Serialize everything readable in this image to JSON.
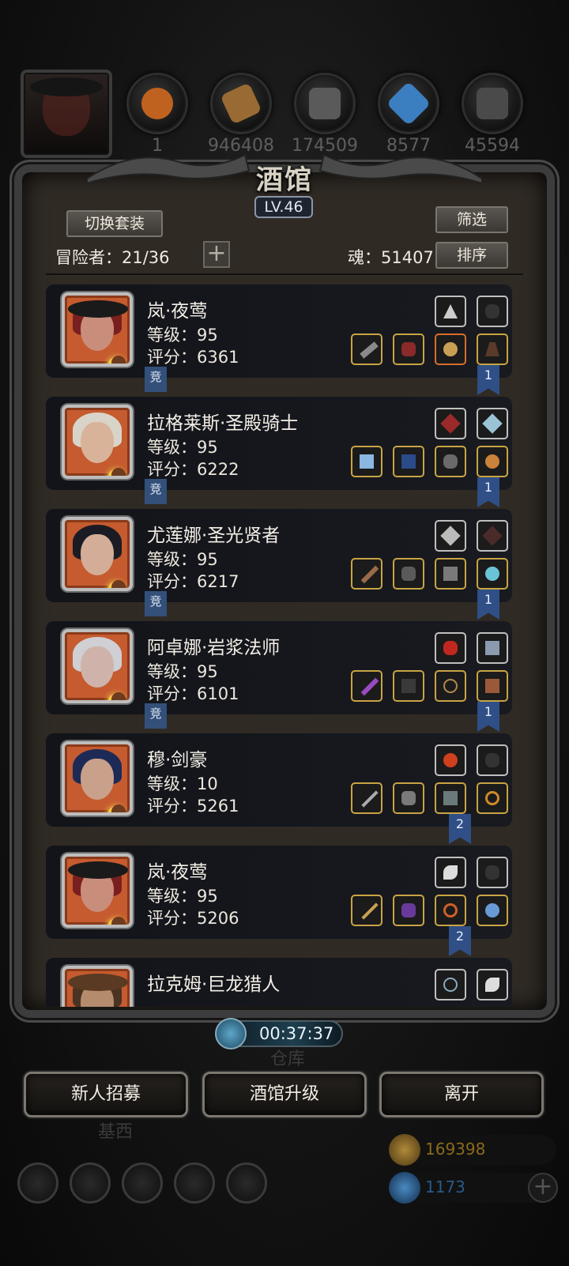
{
  "resources": [
    {
      "id": "res-1",
      "count": "1",
      "color": "#c0621f"
    },
    {
      "id": "res-2",
      "count": "946408",
      "color": "#9a6a34"
    },
    {
      "id": "res-3",
      "count": "174509",
      "color": "#5a5a5a"
    },
    {
      "id": "res-4",
      "count": "8577",
      "color": "#3c7fc0"
    },
    {
      "id": "res-5",
      "count": "45594",
      "color": "#4a4a4a"
    }
  ],
  "panel": {
    "title": "酒馆",
    "level": "LV.46",
    "switch_set_label": "切换套装",
    "filter_label": "筛选",
    "sort_label": "排序",
    "adventurers_text": "冒险者：21/36",
    "soul_text": "魂：51407",
    "plus_glyph": "+"
  },
  "cards": [
    {
      "name": "岚·夜莺",
      "level": "等级：95",
      "score": "评分：6361",
      "badge": "竞",
      "flag": "1",
      "skin": "#c98d7c",
      "hair": "#7a1f1f",
      "hat": true
    },
    {
      "name": "拉格莱斯·圣殿骑士",
      "level": "等级：95",
      "score": "评分：6222",
      "badge": "竞",
      "flag": "1",
      "skin": "#d8b39a",
      "hair": "#d9d4c9",
      "hat": false
    },
    {
      "name": "尤莲娜·圣光贤者",
      "level": "等级：95",
      "score": "评分：6217",
      "badge": "竞",
      "flag": "1",
      "skin": "#d3ad98",
      "hair": "#1b1b24",
      "hat": false
    },
    {
      "name": "阿卓娜·岩浆法师",
      "level": "等级：95",
      "score": "评分：6101",
      "badge": "竞",
      "flag": "1",
      "skin": "#cfb3aa",
      "hair": "#cfcfd4",
      "hat": false
    },
    {
      "name": "穆·剑豪",
      "level": "等级：10",
      "score": "评分：5261",
      "badge": "",
      "flag": "2",
      "skin": "#c9a08a",
      "hair": "#1d2a55",
      "hat": false
    },
    {
      "name": "岚·夜莺",
      "level": "等级：95",
      "score": "评分：5206",
      "badge": "",
      "flag": "2",
      "skin": "#c98d7c",
      "hair": "#7a1f1f",
      "hat": true
    },
    {
      "name": "拉克姆·巨龙猎人",
      "level": "",
      "score": "",
      "badge": "",
      "flag": "",
      "skin": "#b58b6e",
      "hair": "#4a3322",
      "hat": true
    }
  ],
  "timer": "00:37:37",
  "background_labels": {
    "warehouse": "仓库",
    "west": "基西"
  },
  "buttons": {
    "recruit": "新人招募",
    "upgrade": "酒馆升级",
    "leave": "离开"
  },
  "currencies": [
    {
      "value": "169398",
      "color": "#8a6a1c"
    },
    {
      "value": "1173",
      "color": "#2a5a8a"
    }
  ],
  "colors": {
    "accent_blue": "#2f4f86",
    "gold_frame": "#c9a444",
    "orange_frame": "#d86d2a"
  }
}
